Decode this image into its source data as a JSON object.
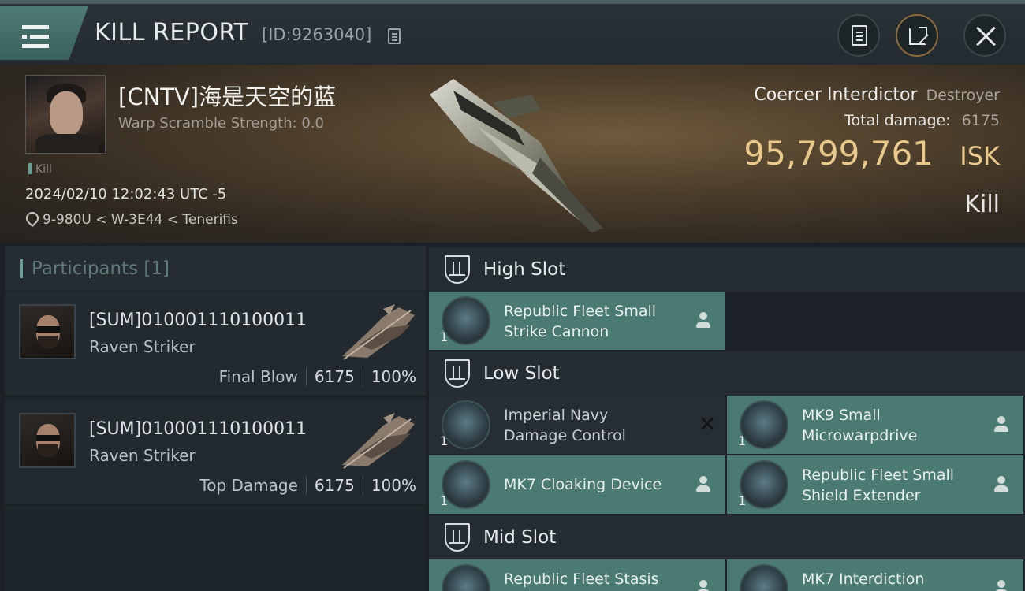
{
  "header": {
    "title": "KILL REPORT",
    "report_id": "[ID:9263040]",
    "icons": [
      "menu-icon",
      "copy-icon",
      "notes-icon",
      "share-icon",
      "close-icon"
    ]
  },
  "victim": {
    "name": "[CNTV]海是天空的蓝",
    "warp_scramble": "Warp Scramble Strength: 0.0",
    "tag": "Kill",
    "timestamp": "2024/02/10 12:02:43 UTC -5",
    "location": "9-980U < W-3E44 < Tenerifis",
    "ship_name": "Coercer Interdictor",
    "ship_class": "Destroyer",
    "total_damage_label": "Total damage:",
    "total_damage": "6175",
    "isk_value": "95,799,761",
    "isk_unit": "ISK",
    "result": "Kill"
  },
  "participants": {
    "title": "Participants",
    "count": "[1]",
    "rows": [
      {
        "name": "[SUM]010001110100011",
        "ship": "Raven Striker",
        "role": "Final Blow",
        "damage": "6175",
        "percent": "100%"
      },
      {
        "name": "[SUM]010001110100011",
        "ship": "Raven Striker",
        "role": "Top Damage",
        "damage": "6175",
        "percent": "100%"
      }
    ]
  },
  "fitting": {
    "high_slot": {
      "title": "High Slot",
      "items": [
        {
          "name_line1": "Republic Fleet Small",
          "name_line2": "Strike Cannon",
          "qty": "1",
          "status": "dropped"
        }
      ]
    },
    "low_slot": {
      "title": "Low Slot",
      "items": [
        {
          "name_line1": "Imperial Navy",
          "name_line2": "Damage Control",
          "qty": "1",
          "status": "destroyed"
        },
        {
          "name_line1": "MK9 Small",
          "name_line2": "Microwarpdrive",
          "qty": "1",
          "status": "dropped"
        },
        {
          "name_line1": "MK7 Cloaking Device",
          "name_line2": "",
          "qty": "1",
          "status": "dropped"
        },
        {
          "name_line1": "Republic Fleet Small",
          "name_line2": "Shield Extender",
          "qty": "1",
          "status": "dropped"
        }
      ]
    },
    "mid_slot": {
      "title": "Mid Slot",
      "items": [
        {
          "name_line1": "Republic Fleet Stasis",
          "name_line2": "",
          "qty": "",
          "status": "dropped"
        },
        {
          "name_line1": "MK7 Interdiction",
          "name_line2": "",
          "qty": "",
          "status": "dropped"
        }
      ]
    }
  },
  "colors": {
    "accent_teal": "#4b7a72",
    "isk_gold": "#e9c98c",
    "background": "#1b2126"
  }
}
